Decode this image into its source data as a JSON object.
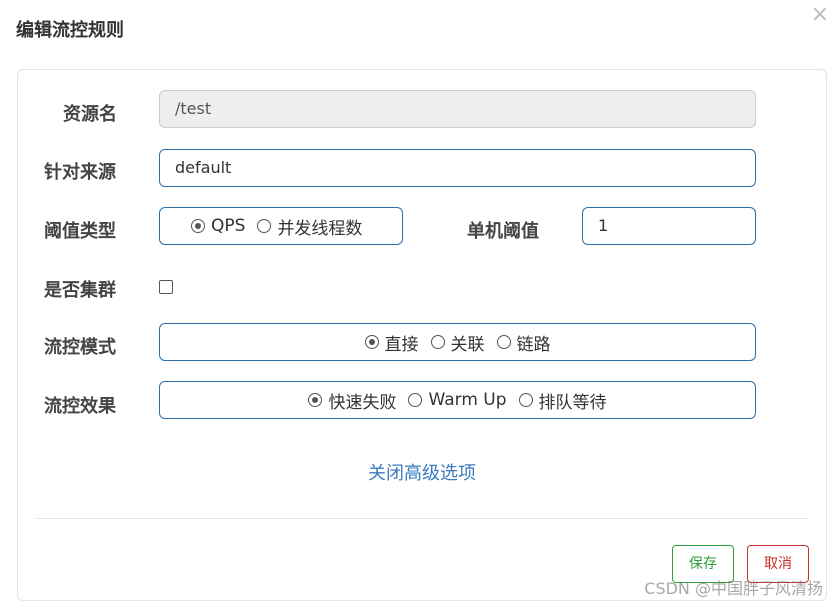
{
  "dialog": {
    "title": "编辑流控规则",
    "close_glyph": "×"
  },
  "form": {
    "resource": {
      "label": "资源名",
      "value": "/test"
    },
    "source": {
      "label": "针对来源",
      "value": "default"
    },
    "threshold_type": {
      "label": "阈值类型",
      "options": [
        {
          "label": "QPS",
          "checked": true
        },
        {
          "label": "并发线程数",
          "checked": false
        }
      ]
    },
    "single_threshold": {
      "label": "单机阈值",
      "value": "1"
    },
    "cluster": {
      "label": "是否集群",
      "checked": false
    },
    "flow_mode": {
      "label": "流控模式",
      "options": [
        {
          "label": "直接",
          "checked": true
        },
        {
          "label": "关联",
          "checked": false
        },
        {
          "label": "链路",
          "checked": false
        }
      ]
    },
    "flow_effect": {
      "label": "流控效果",
      "options": [
        {
          "label": "快速失败",
          "checked": true
        },
        {
          "label": "Warm Up",
          "checked": false
        },
        {
          "label": "排队等待",
          "checked": false
        }
      ]
    },
    "advanced_link": "关闭高级选项"
  },
  "buttons": {
    "save": "保存",
    "cancel": "取消"
  },
  "watermark": "CSDN @中国胖子风清扬",
  "colors": {
    "input_border": "#2e6da4",
    "link": "#3a7bc0",
    "save": "#2e9e3a",
    "cancel": "#c9302c"
  }
}
